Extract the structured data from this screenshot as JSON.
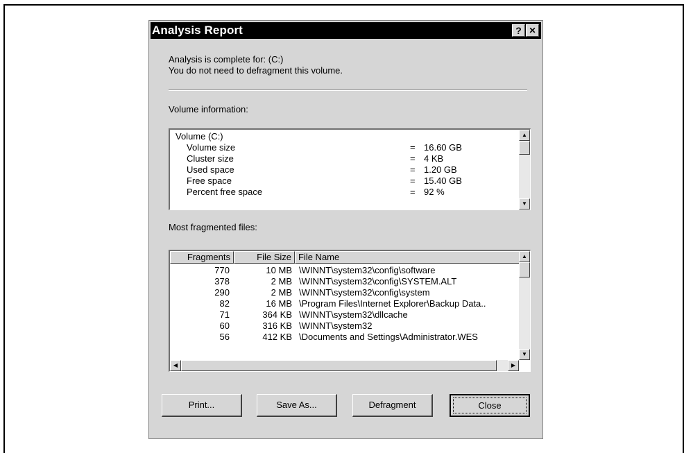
{
  "window": {
    "title": "Analysis Report",
    "help_glyph": "?",
    "close_glyph": "✕"
  },
  "status": {
    "line1": "Analysis is complete for: (C:)",
    "line2": "You do not need to defragment this volume."
  },
  "volume": {
    "label": "Volume information:",
    "header": "Volume (C:)",
    "rows": [
      {
        "name": "Volume size",
        "eq": "=",
        "value": "16.60 GB"
      },
      {
        "name": "Cluster size",
        "eq": "=",
        "value": "4 KB"
      },
      {
        "name": "Used space",
        "eq": "=",
        "value": "1.20 GB"
      },
      {
        "name": "Free space",
        "eq": "=",
        "value": "15.40 GB"
      },
      {
        "name": "Percent free space",
        "eq": "=",
        "value": "92 %"
      }
    ]
  },
  "files": {
    "label": "Most fragmented files:",
    "columns": [
      "Fragments",
      "File Size",
      "File Name"
    ],
    "rows": [
      {
        "fragments": "770",
        "size": "10 MB",
        "name": "\\WINNT\\system32\\config\\software"
      },
      {
        "fragments": "378",
        "size": "2 MB",
        "name": "\\WINNT\\system32\\config\\SYSTEM.ALT"
      },
      {
        "fragments": "290",
        "size": "2 MB",
        "name": "\\WINNT\\system32\\config\\system"
      },
      {
        "fragments": "82",
        "size": "16 MB",
        "name": "\\Program Files\\Internet Explorer\\Backup Data.."
      },
      {
        "fragments": "71",
        "size": "364 KB",
        "name": "\\WINNT\\system32\\dllcache"
      },
      {
        "fragments": "60",
        "size": "316 KB",
        "name": "\\WINNT\\system32"
      },
      {
        "fragments": "56",
        "size": "412 KB",
        "name": "\\Documents and Settings\\Administrator.WES"
      }
    ]
  },
  "buttons": {
    "print": "Print...",
    "save_as": "Save As...",
    "defragment": "Defragment",
    "close": "Close"
  }
}
